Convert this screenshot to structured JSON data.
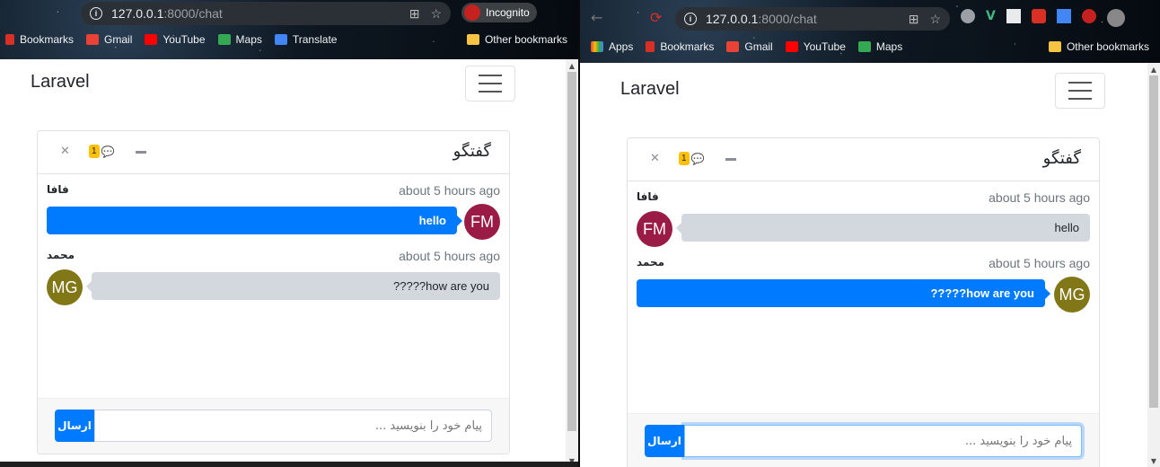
{
  "left": {
    "url_host": "127.0.0.1",
    "url_rest": ":8000/chat",
    "incognito_label": "Incognito",
    "bookmarks": [
      "Bookmarks",
      "Gmail",
      "YouTube",
      "Maps",
      "Translate",
      "Other bookmarks"
    ],
    "brand": "Laravel",
    "chat": {
      "title": "گفتگو",
      "unread_count": "1",
      "messages": [
        {
          "user": "فافا",
          "time": "about 5 hours ago",
          "initials": "FM",
          "text": "hello"
        },
        {
          "user": "محمد",
          "time": "about 5 hours ago",
          "initials": "MG",
          "text": "?????how are you"
        }
      ],
      "send_label": "ارسال",
      "input_placeholder": "پیام خود را بنویسید ..."
    }
  },
  "right": {
    "url_host": "127.0.0.1",
    "url_rest": ":8000/chat",
    "bookmarks": [
      "Apps",
      "Bookmarks",
      "Gmail",
      "YouTube",
      "Maps",
      "Other bookmarks"
    ],
    "brand": "Laravel",
    "chat": {
      "title": "گفتگو",
      "unread_count": "1",
      "messages": [
        {
          "user": "فافا",
          "time": "about 5 hours ago",
          "initials": "FM",
          "text": "hello"
        },
        {
          "user": "محمد",
          "time": "about 5 hours ago",
          "initials": "MG",
          "text": "?????how are you"
        }
      ],
      "send_label": "ارسال",
      "input_placeholder": "پیام خود را بنویسید ..."
    }
  },
  "colors": {
    "blue": "#007bff",
    "fm_avatar": "#9b1b47",
    "mg_avatar": "#827717",
    "badge": "#ffc107"
  }
}
